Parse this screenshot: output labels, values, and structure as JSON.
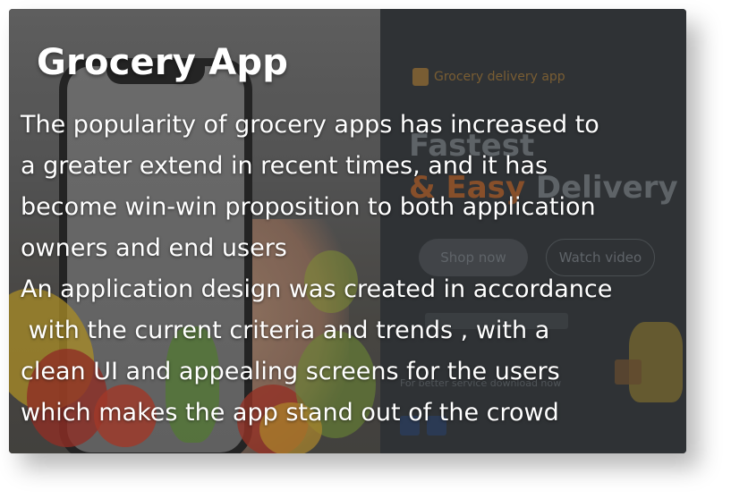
{
  "card": {
    "title": "Grocery App",
    "description_lines": [
      "The popularity of grocery apps has increased to",
      "a greater extend in recent times, and it has",
      "become win-win proposition to both application",
      "owners and end users",
      "An application design was created in accordance",
      " with the current criteria and trends , with a",
      "clean UI and appealing screens for the users",
      "which makes the app stand out of the crowd"
    ]
  },
  "preview": {
    "brand": "Grocery delivery app",
    "headline_1": "Fastest",
    "headline_2_accent": "& Easy",
    "headline_2_rest": " Delivery",
    "primary_button": "Shop now",
    "secondary_button": "Watch video",
    "download_note": "For better service download now"
  },
  "colors": {
    "text": "#ffffff",
    "preview_bg": "#363a3d",
    "accent": "#9a5a30"
  }
}
